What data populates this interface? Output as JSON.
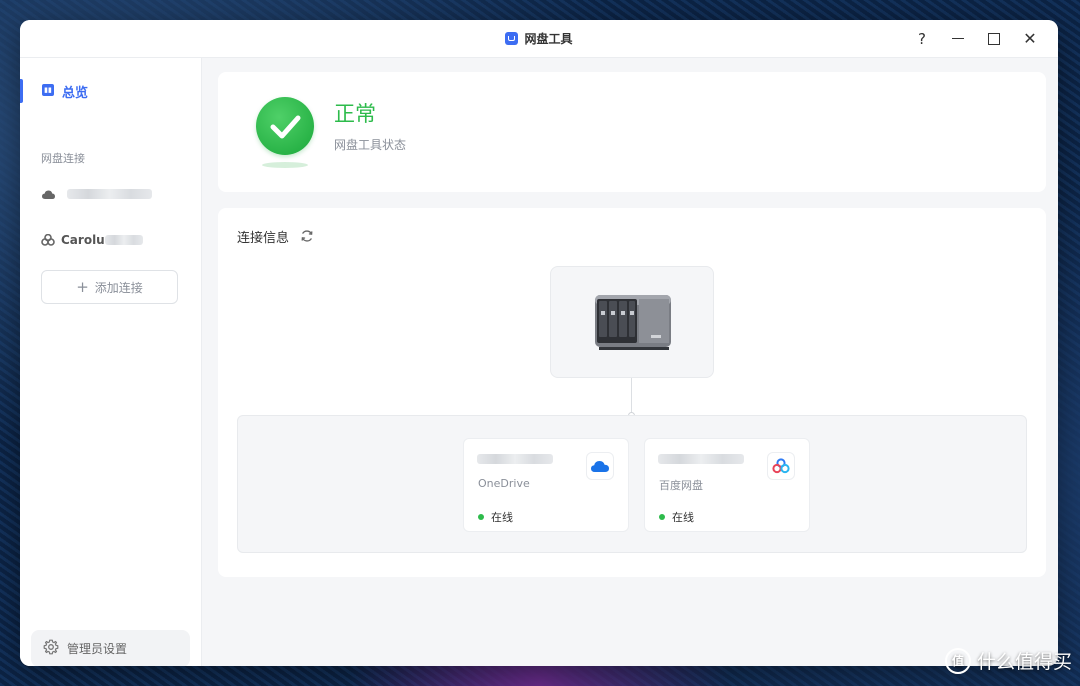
{
  "app": {
    "title": "网盘工具",
    "help": "?",
    "minimize_icon": "minimize-icon",
    "maximize_icon": "maximize-icon",
    "close": "✕"
  },
  "sidebar": {
    "overview": {
      "label": "总览",
      "icon": "dashboard-icon"
    },
    "section_label": "网盘连接",
    "connections": [
      {
        "label": "",
        "icon": "cloud-icon"
      },
      {
        "label": "Carolu",
        "icon": "baidu-cloud-icon"
      }
    ],
    "add_button": {
      "plus": "+",
      "label": "添加连接"
    },
    "admin_button": {
      "label": "管理员设置",
      "icon": "gear-icon"
    }
  },
  "status": {
    "title": "正常",
    "subtitle": "网盘工具状态",
    "icon": "check-icon",
    "color": "#2dbb4b"
  },
  "connection_info": {
    "title": "连接信息",
    "refresh_icon": "refresh-icon",
    "device_icon": "nas-device-icon",
    "drives": [
      {
        "provider": "OneDrive",
        "status": "在线",
        "logo": "onedrive-icon"
      },
      {
        "provider": "百度网盘",
        "status": "在线",
        "logo": "baidu-netdisk-icon"
      }
    ]
  },
  "watermark": {
    "text": "什么值得买",
    "logo": "值"
  }
}
